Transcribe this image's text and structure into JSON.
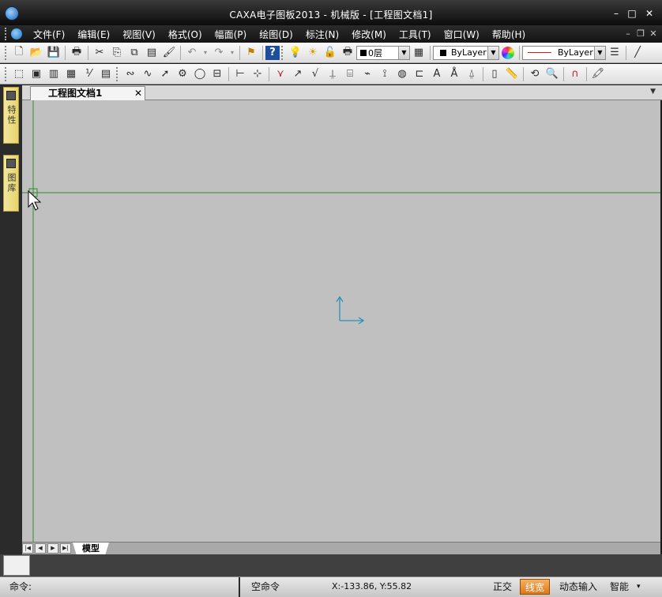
{
  "window": {
    "title": "CAXA电子图板2013 - 机械版 - [工程图文档1]",
    "controls": {
      "minimize": "–",
      "maximize": "□",
      "close": "✕"
    }
  },
  "menubar": {
    "items": [
      "文件(F)",
      "编辑(E)",
      "视图(V)",
      "格式(O)",
      "幅面(P)",
      "绘图(D)",
      "标注(N)",
      "修改(M)",
      "工具(T)",
      "窗口(W)",
      "帮助(H)"
    ],
    "mdi_controls": {
      "minimize": "–",
      "restore": "❐",
      "close": "✕"
    }
  },
  "toolbar1": {
    "layer_value": "0层",
    "color_value": "ByLayer",
    "linetype_value": "ByLayer"
  },
  "left_panel": {
    "tabs": [
      "特性",
      "图库"
    ]
  },
  "document": {
    "tab_label": "工程图文档1",
    "tab_close": "✕"
  },
  "sheets": {
    "tabs": [
      "模型"
    ]
  },
  "statusbar": {
    "command_label": "命令:",
    "command_state": "空命令",
    "coordinates": "X:-133.86, Y:55.82",
    "ortho": "正交",
    "linewidth": "线宽",
    "dynamic_input": "动态输入",
    "snap_mode": "智能",
    "active_toggle": "线宽"
  },
  "colors": {
    "canvas": "#c0c0c0",
    "crosshair": "#2e8b2e",
    "ucs_axis": "#2a8fb8",
    "side_tab": "#efe08a",
    "active_status": "#e8841a"
  }
}
